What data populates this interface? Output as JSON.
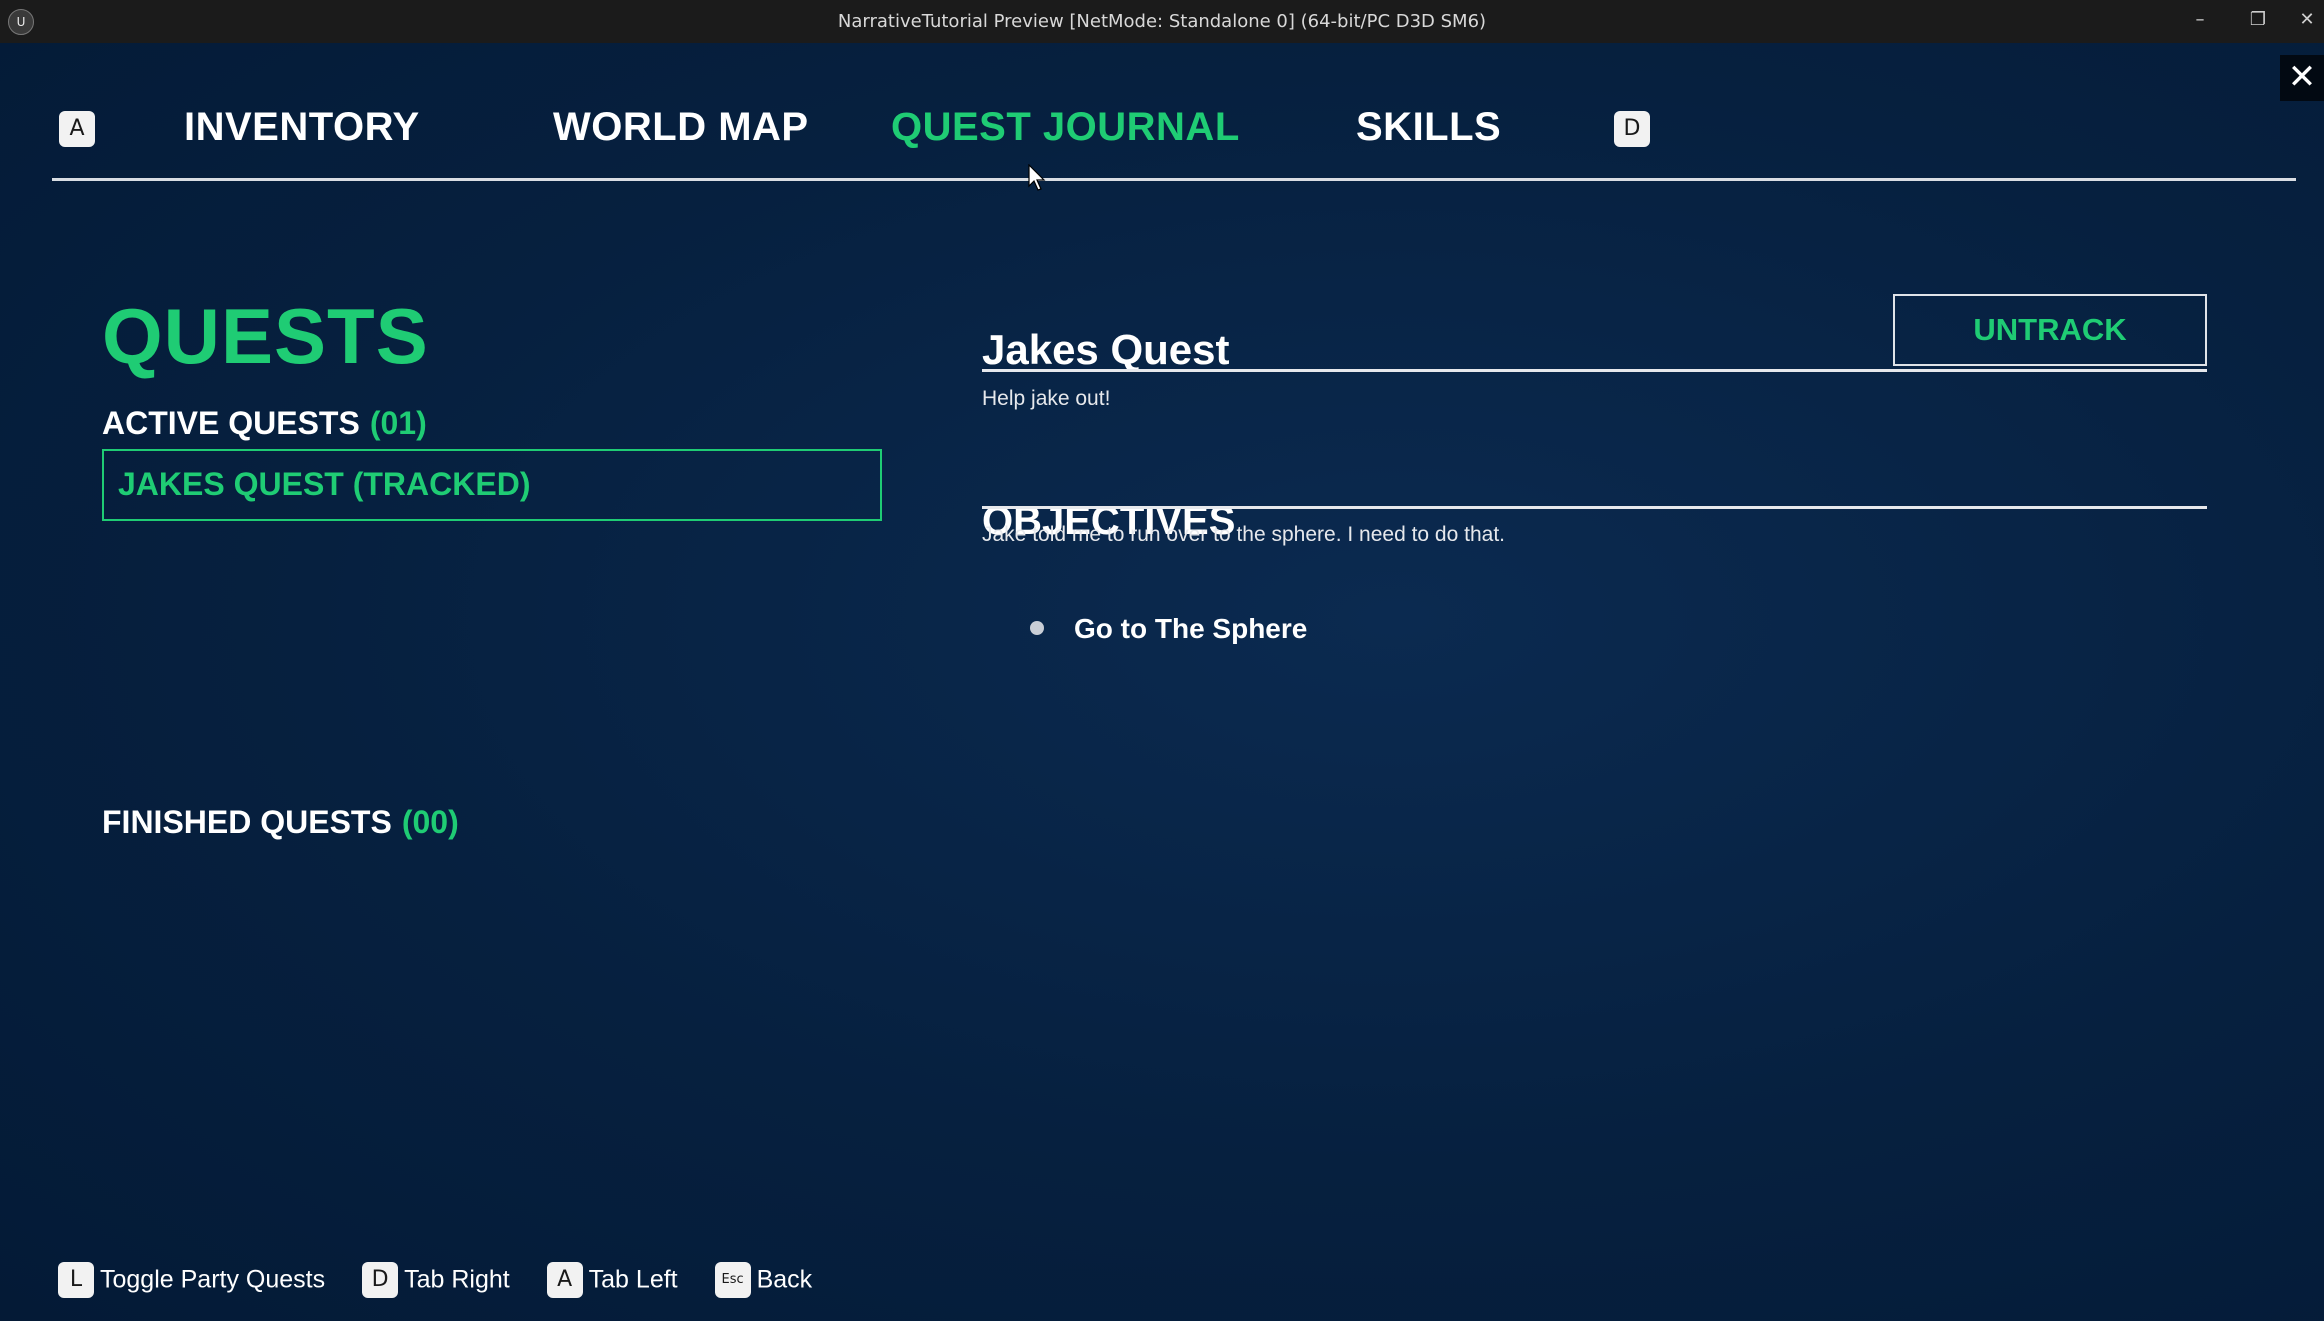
{
  "window": {
    "title": "NarrativeTutorial Preview [NetMode: Standalone 0]  (64-bit/PC D3D SM6)",
    "logo_glyph": "U",
    "minimize_glyph": "–",
    "restore_glyph": "❐",
    "close_glyph": "✕"
  },
  "overlay": {
    "close_glyph": "✕"
  },
  "tabs": {
    "left_key": "A",
    "right_key": "D",
    "items": [
      {
        "label": "INVENTORY",
        "active": false
      },
      {
        "label": "WORLD MAP",
        "active": false
      },
      {
        "label": "QUEST JOURNAL",
        "active": true
      },
      {
        "label": "SKILLS",
        "active": false
      }
    ]
  },
  "quests": {
    "title": "QUESTS",
    "active_label": "ACTIVE QUESTS",
    "active_count": "(01)",
    "active_items": [
      "JAKES QUEST (TRACKED)"
    ],
    "finished_label": "FINISHED QUESTS",
    "finished_count": "(00)"
  },
  "detail": {
    "quest_name": "Jakes Quest",
    "untrack_label": "UNTRACK",
    "description": "Help jake out!",
    "objectives_title": "OBJECTIVES",
    "objectives_description": "Jake told me to run over to the sphere. I need to do that.",
    "objectives": [
      "Go to The Sphere"
    ]
  },
  "footer": {
    "hints": [
      {
        "key": "L",
        "label": "Toggle Party Quests"
      },
      {
        "key": "D",
        "label": "Tab Right"
      },
      {
        "key": "A",
        "label": "Tab Left"
      },
      {
        "key": "Esc",
        "label": "Back"
      }
    ]
  },
  "colors": {
    "accent": "#1fcc74",
    "background": "#06203f",
    "titlebar": "#1b1b1b"
  }
}
